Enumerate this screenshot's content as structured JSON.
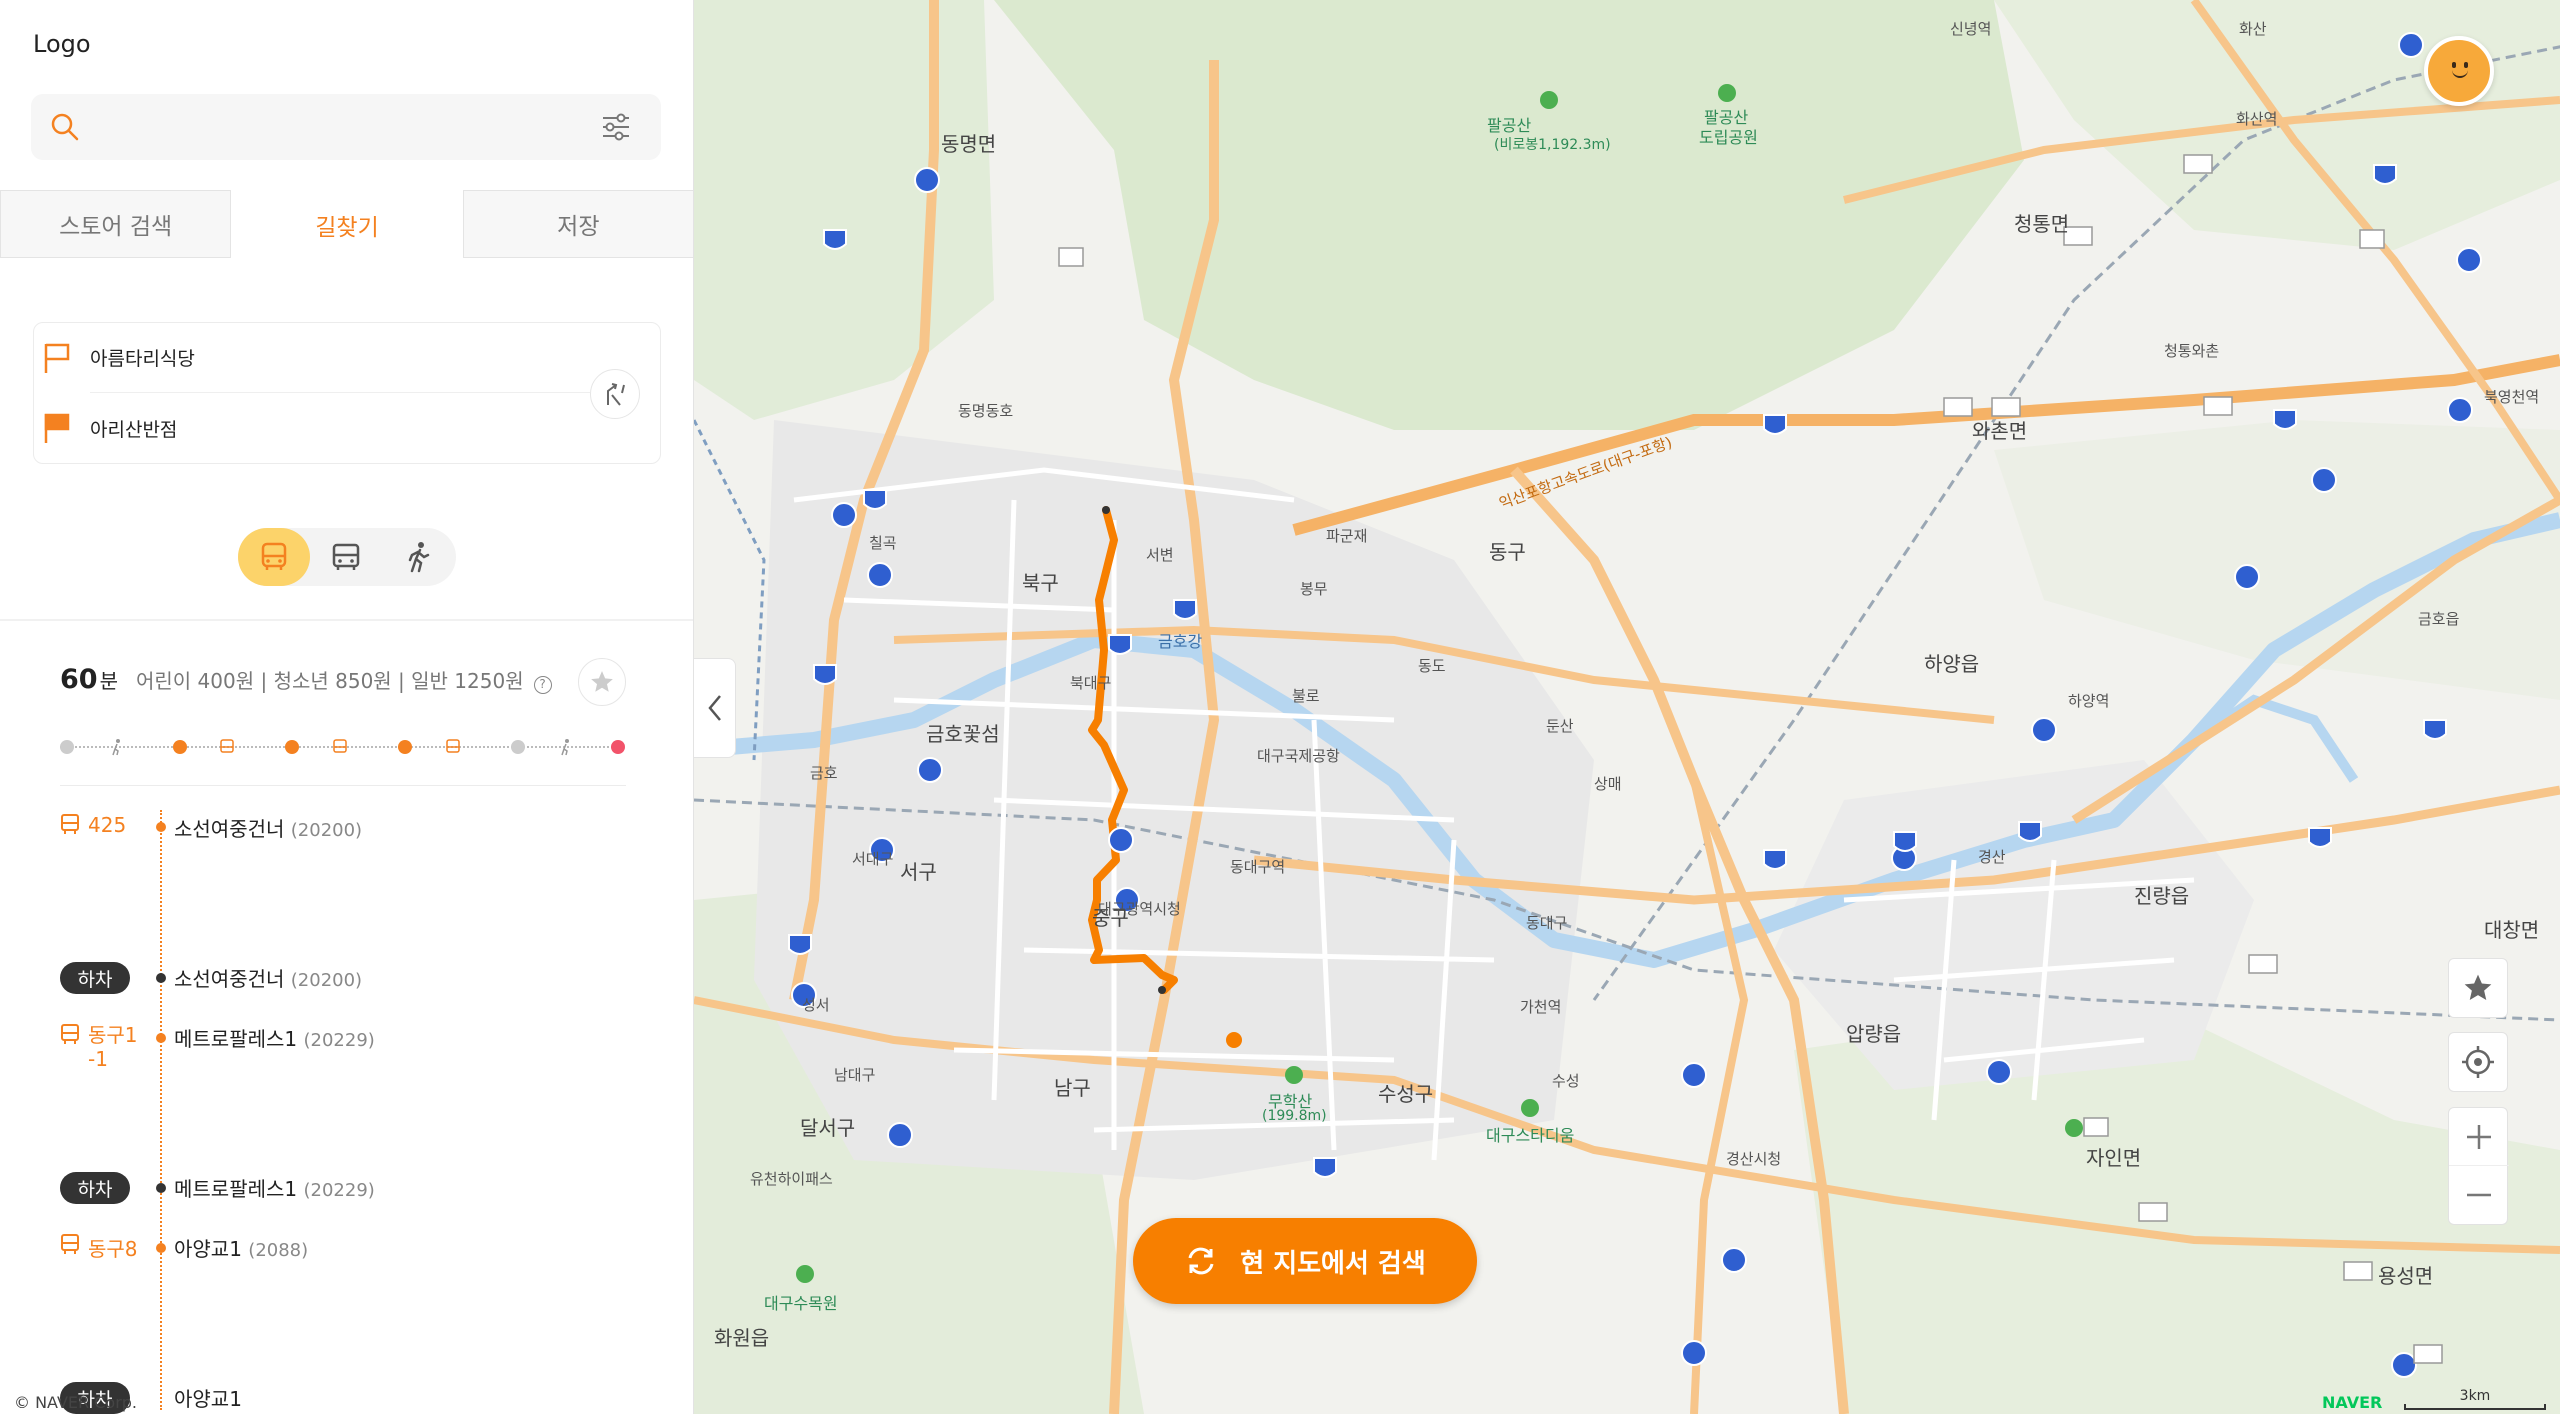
{
  "logo": "Logo",
  "search": {
    "placeholder": ""
  },
  "tabs": [
    {
      "label": "스토어 검색"
    },
    {
      "label": "길찾기"
    },
    {
      "label": "저장"
    }
  ],
  "route": {
    "origin": "아름타리식당",
    "destination": "아리산반점"
  },
  "result": {
    "duration": "60",
    "duration_unit": "분",
    "fare": "어린이 400원 | 청소년 850원 | 일반 1250원"
  },
  "legs": [
    {
      "bus": "425",
      "stop": "소선여중건너",
      "code": "(20200)"
    },
    {
      "off": "하차",
      "stop": "소선여중건너",
      "code": "(20200)"
    },
    {
      "bus": "동구1-1",
      "stop": "메트로팔레스1",
      "code": "(20229)"
    },
    {
      "off": "하차",
      "stop": "메트로팔레스1",
      "code": "(20229)"
    },
    {
      "bus": "동구8",
      "stop": "아양교1",
      "code": "(2088)"
    },
    {
      "off": "하차",
      "stop": "아양교1",
      "code": ""
    }
  ],
  "copyright": "© NAVER Corp.",
  "map": {
    "search_here": "현 지도에서 검색",
    "brand": "NAVER",
    "scale": "3km",
    "labels": {
      "dongmyeon": "동명면",
      "palgongsan": "팔공산",
      "palgong_peak": "(비로봉1,192.3m)",
      "palgong_park": "팔공산",
      "palgong_park2": "도립공원",
      "sinnyeong": "신녕역",
      "hwasan": "화산역",
      "cheongtong": "청통면",
      "cheongtong_ic": "청통와촌",
      "wachon": "와촌면",
      "dongmyeong_jc": "동명동호",
      "chilgok": "칠곡",
      "seobyeon": "서변",
      "bukgu": "북구",
      "palgunjae": "파군재",
      "bongmu": "봉무",
      "dong_gu": "동구",
      "geumho_river": "금호강",
      "dongho_jc": "동도",
      "bulro": "불로",
      "airport": "대구국제공항",
      "dunsan": "둔산",
      "sangmae": "상매",
      "hayang": "하양읍",
      "hayang_st": "하양역",
      "geumho_town": "금호꽃섬",
      "bukdaegu": "북대구",
      "geumho_jc": "금호",
      "seodaegu": "서대구",
      "seogu": "서구",
      "junggu": "중구",
      "dongdaegu": "동대구역",
      "cityhall": "대구광역시청",
      "dongdaegu_ic": "동대구",
      "gyeongsan": "경산",
      "jinryang": "진량읍",
      "gacheon": "가천역",
      "apnyang": "압량읍",
      "seongseo": "성서",
      "namdaegu": "남대구",
      "namgu": "남구",
      "suseong": "수성구",
      "suseong_ic": "수성",
      "muhaksan": "무학산",
      "muhaksan_h": "(199.8m)",
      "stadium": "대구스타디움",
      "dalseo": "달서구",
      "yuchon": "유천하이패스",
      "gyeongsan_city": "경산시청",
      "jain": "자인면",
      "arboretum": "대구수목원",
      "hwawon": "화원읍",
      "yongseong": "용성면",
      "bukyeongcheon": "북영천역",
      "daechang": "대창면",
      "geumho_eup": "금호읍",
      "hwasan_ic": "화산",
      "palgong_exp": "익산포항고속도로(대구-포항)"
    }
  }
}
